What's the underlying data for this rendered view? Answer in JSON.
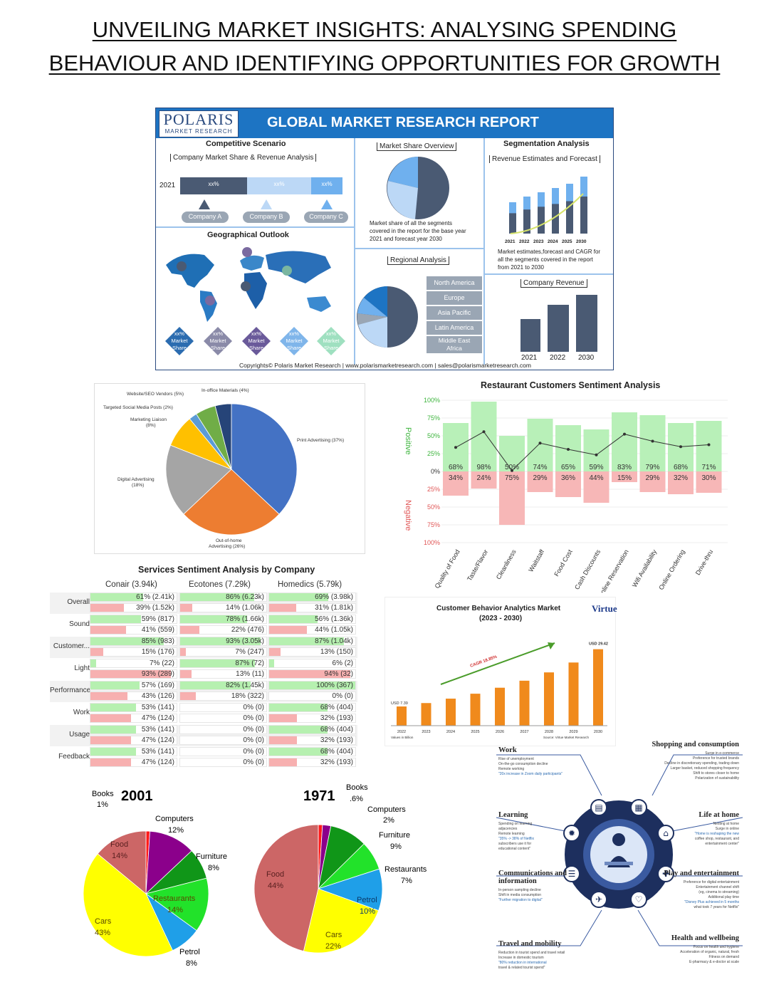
{
  "page_title": [
    "UNVEILING MARKET INSIGHTS: ANALYSING SPENDING",
    "BEHAVIOUR AND IDENTIFYING OPPORTUNITIES FOR GROWTH"
  ],
  "polaris": {
    "logo": "POLARIS",
    "logo_sub": "MARKET RESEARCH",
    "header": "GLOBAL MARKET RESEARCH REPORT",
    "competitive": "Competitive Scenario",
    "company_share": "Company Market Share & Revenue Analysis",
    "year": "2021",
    "bar_labels": [
      "xx%",
      "xx%",
      "xx%"
    ],
    "companies": [
      "Company A",
      "Company B",
      "Company C"
    ],
    "geo": "Geographical Outlook",
    "diamond_lines": [
      "xx%",
      "Market",
      "Share"
    ],
    "ms_overview": "Market Share Overview",
    "ms_desc": "Market share of all the segments covered in the report for the base year 2021 and forecast year 2030",
    "regional": "Regional Analysis",
    "regions": [
      "North America",
      "Europe",
      "Asia Pacific",
      "Latin America",
      "Middle East Africa"
    ],
    "segmentation": "Segmentation Analysis",
    "rev_est": "Revenue Estimates and Forecast",
    "seg_years": [
      "2021",
      "2022",
      "2023",
      "2024",
      "2025",
      "2030"
    ],
    "seg_desc": "Market estimates,forecast and CAGR for all the segments covered in the report from 2021 to 2030",
    "company_revenue": "Company Revenue",
    "rev_years": [
      "2021",
      "2022",
      "2030"
    ],
    "copyright": "Copyrights© Polaris Market Research | www.polarismarketresearch.com | sales@polarismarketresearch.com",
    "colors": {
      "navy": "#2a4a7f",
      "blue": "#1d74c3",
      "slate": "#4a5a73",
      "light": "#a9d0f5"
    }
  },
  "ad_pie": {
    "chart_data": {
      "type": "pie",
      "labels": [
        "Print Advertising (37%)",
        "Out-of-home Advertising (26%)",
        "Digital Advertising (18%)",
        "Marketing Liaison (8%)",
        "Targeted Social Media Posts (2%)",
        "Website/SEO Vendors (5%)",
        "In-office Materials (4%)"
      ],
      "values": [
        37,
        26,
        18,
        8,
        2,
        5,
        4
      ],
      "colors": [
        "#4472c4",
        "#ed7d31",
        "#a5a5a5",
        "#ffc000",
        "#5b9bd5",
        "#70ad47",
        "#264478"
      ]
    }
  },
  "sentiment": {
    "chart_data": {
      "type": "bar",
      "title": "Restaurant Customers Sentiment Analysis",
      "categories": [
        "Quality of Food",
        "Taste/Flavor",
        "Cleanliness",
        "Waitstaff",
        "Food Cost",
        "Cash Discounts",
        "Online Reservation",
        "Wifi Availability",
        "Online Ordering",
        "Drive-thru"
      ],
      "series": [
        {
          "name": "Positive",
          "values": [
            68,
            98,
            50,
            74,
            65,
            59,
            83,
            79,
            68,
            71
          ]
        },
        {
          "name": "Negative",
          "values": [
            34,
            24,
            75,
            29,
            36,
            44,
            15,
            29,
            32,
            30
          ]
        }
      ],
      "pos_labels": [
        "68%",
        "98%",
        "50%",
        "74%",
        "65%",
        "59%",
        "83%",
        "79%",
        "68%",
        "71%"
      ],
      "neg_labels": [
        "34%",
        "24%",
        "75%",
        "29%",
        "36%",
        "44%",
        "15%",
        "29%",
        "32%",
        "30%"
      ],
      "ylabel_pos": "Positive",
      "ylabel_neg": "Negative",
      "ticks": [
        "100%",
        "75%",
        "50%",
        "25%",
        "0%",
        "25%",
        "50%",
        "75%",
        "100%"
      ],
      "ylim": [
        -100,
        100
      ]
    }
  },
  "services": {
    "chart_data": {
      "type": "table",
      "title": "Services Sentiment Analysis by Company",
      "companies": [
        "Conair (3.94k)",
        "Ecotones (7.29k)",
        "Homedics (5.79k)"
      ],
      "rows": [
        {
          "label": "Overall",
          "vals": [
            [
              61,
              39
            ],
            [
              86,
              14
            ],
            [
              69,
              31
            ]
          ],
          "txt": [
            [
              "61% (2.41k)",
              "39% (1.52k)"
            ],
            [
              "86% (6.23k)",
              "14% (1.06k)"
            ],
            [
              "69% (3.98k)",
              "31% (1.81k)"
            ]
          ]
        },
        {
          "label": "Sound",
          "vals": [
            [
              59,
              41
            ],
            [
              78,
              22
            ],
            [
              56,
              44
            ]
          ],
          "txt": [
            [
              "59% (817)",
              "41% (559)"
            ],
            [
              "78% (1.66k)",
              "22% (476)"
            ],
            [
              "56% (1.36k)",
              "44% (1.05k)"
            ]
          ]
        },
        {
          "label": "Customer...",
          "vals": [
            [
              85,
              15
            ],
            [
              93,
              7
            ],
            [
              87,
              13
            ]
          ],
          "txt": [
            [
              "85% (983)",
              "15% (176)"
            ],
            [
              "93% (3.05k)",
              "7% (247)"
            ],
            [
              "87% (1.04k)",
              "13% (150)"
            ]
          ]
        },
        {
          "label": "Light",
          "vals": [
            [
              7,
              93
            ],
            [
              87,
              13
            ],
            [
              6,
              94
            ]
          ],
          "txt": [
            [
              "7% (22)",
              "93% (289)"
            ],
            [
              "87% (72)",
              "13% (11)"
            ],
            [
              "6% (2)",
              "94% (32)"
            ]
          ]
        },
        {
          "label": "Performance",
          "vals": [
            [
              57,
              43
            ],
            [
              82,
              18
            ],
            [
              100,
              0
            ]
          ],
          "txt": [
            [
              "57% (169)",
              "43% (126)"
            ],
            [
              "82% (1.45k)",
              "18% (322)"
            ],
            [
              "100% (367)",
              "0% (0)"
            ]
          ]
        },
        {
          "label": "Work",
          "vals": [
            [
              53,
              47
            ],
            [
              0,
              0
            ],
            [
              68,
              32
            ]
          ],
          "txt": [
            [
              "53% (141)",
              "47% (124)"
            ],
            [
              "0% (0)",
              "0% (0)"
            ],
            [
              "68% (404)",
              "32% (193)"
            ]
          ]
        },
        {
          "label": "Usage",
          "vals": [
            [
              53,
              47
            ],
            [
              0,
              0
            ],
            [
              68,
              32
            ]
          ],
          "txt": [
            [
              "53% (141)",
              "47% (124)"
            ],
            [
              "0% (0)",
              "0% (0)"
            ],
            [
              "68% (404)",
              "32% (193)"
            ]
          ]
        },
        {
          "label": "Feedback",
          "vals": [
            [
              53,
              47
            ],
            [
              0,
              0
            ],
            [
              68,
              32
            ]
          ],
          "txt": [
            [
              "53% (141)",
              "47% (124)"
            ],
            [
              "0% (0)",
              "0% (0)"
            ],
            [
              "68% (404)",
              "32% (193)"
            ]
          ]
        }
      ]
    }
  },
  "cba": {
    "chart_data": {
      "type": "bar",
      "title": "Customer Behavior Analytics Market",
      "subtitle": "(2023 - 2030)",
      "categories": [
        "2022",
        "2023",
        "2024",
        "2025",
        "2026",
        "2027",
        "2028",
        "2029",
        "2030"
      ],
      "values": [
        7.39,
        8.7,
        10.4,
        12.3,
        14.6,
        17.3,
        20.5,
        24.3,
        29.42
      ],
      "first_label": "USD 7.39",
      "last_label": "USD 29.42",
      "cagr": "CAGR 18.85%",
      "xnote": "Values in Billion",
      "source": "Source: Virtue Market Research",
      "logo": "Virtue"
    }
  },
  "pie_2001": {
    "chart_data": {
      "type": "pie",
      "title": "2001",
      "labels": [
        "Books",
        "Computers",
        "Furniture",
        "Restaurants",
        "Petrol",
        "Cars",
        "Food"
      ],
      "pct_labels": [
        "1%",
        "12%",
        "8%",
        "14%",
        "8%",
        "43%",
        "14%"
      ],
      "values": [
        1,
        12,
        8,
        14,
        8,
        43,
        14
      ],
      "colors": [
        "#ff1a1a",
        "#8b008b",
        "#109618",
        "#22e22a",
        "#1f9fe8",
        "#ffff00",
        "#cc6666"
      ]
    }
  },
  "pie_1971": {
    "chart_data": {
      "type": "pie",
      "title": "1971",
      "labels": [
        "Books",
        "Computers",
        "Furniture",
        "Restaurants",
        "Petrol",
        "Cars",
        "Food"
      ],
      "pct_labels": [
        ".6%",
        "2%",
        "9%",
        "7%",
        "10%",
        "22%",
        "44%"
      ],
      "values": [
        6,
        2,
        9,
        7,
        10,
        22,
        44
      ],
      "colors": [
        "#ff1a1a",
        "#8b008b",
        "#109618",
        "#22e22a",
        "#1f9fe8",
        "#ffff00",
        "#cc6666"
      ]
    }
  },
  "wheel": {
    "sections": [
      {
        "h": "Work",
        "lines": [
          "Rise of unemployment",
          "On-the-go consumption decline",
          "Remote working",
          "\"20x increase in Zoom daily participants\""
        ]
      },
      {
        "h": "Learning",
        "lines": [
          "Spending on learning",
          "adjacencies",
          "Remote learning",
          "\"35% -> 38% of Netflix",
          "subscribers use it for",
          "educational content\""
        ]
      },
      {
        "h": "Communications and information",
        "lines": [
          "In-person sampling decline",
          "Shift in media consumption",
          "\"Further migration to digital\""
        ]
      },
      {
        "h": "Travel and mobility",
        "lines": [
          "Reduction in tourist spend and travel retail",
          "Increase in domestic tourism",
          "\"80% reduction in international",
          "travel & related tourist spend\""
        ]
      },
      {
        "h": "Shopping and consumption",
        "lines": [
          "Surge in e-commerce",
          "Preference for trusted brands",
          "Decline in discretionary spending, trading down",
          "Larger basket, reduced shopping frequency",
          "Shift to stores closer to home",
          "Polarization of sustainability"
        ]
      },
      {
        "h": "Life at home",
        "lines": [
          "Nesting at home",
          "Surge in online",
          "\"Home is reshaping the new",
          "coffee shop, restaurant, and",
          "entertainment center\""
        ]
      },
      {
        "h": "Play and entertainment",
        "lines": [
          "Preference for digital entertainment",
          "Entertainment channel shift",
          "(eg, cinema to streaming)",
          "Additional play time",
          "\"Disney Plus achieved in 5 months",
          "what took 7 years for Netflix\""
        ]
      },
      {
        "h": "Health and wellbeing",
        "lines": [
          "Focus on health and hygiene",
          "Acceleration of organic, natural, fresh",
          "Fitness on demand",
          "E-pharmacy & e-doctor at scale"
        ]
      }
    ],
    "icons": [
      "calendar-icon",
      "basket-icon",
      "bulb-icon",
      "home-icon",
      "chat-icon",
      "gamepad-icon",
      "plane-icon",
      "heart-icon"
    ],
    "colors": {
      "dark": "#1d2f5e",
      "mid": "#3a5aa0"
    }
  }
}
